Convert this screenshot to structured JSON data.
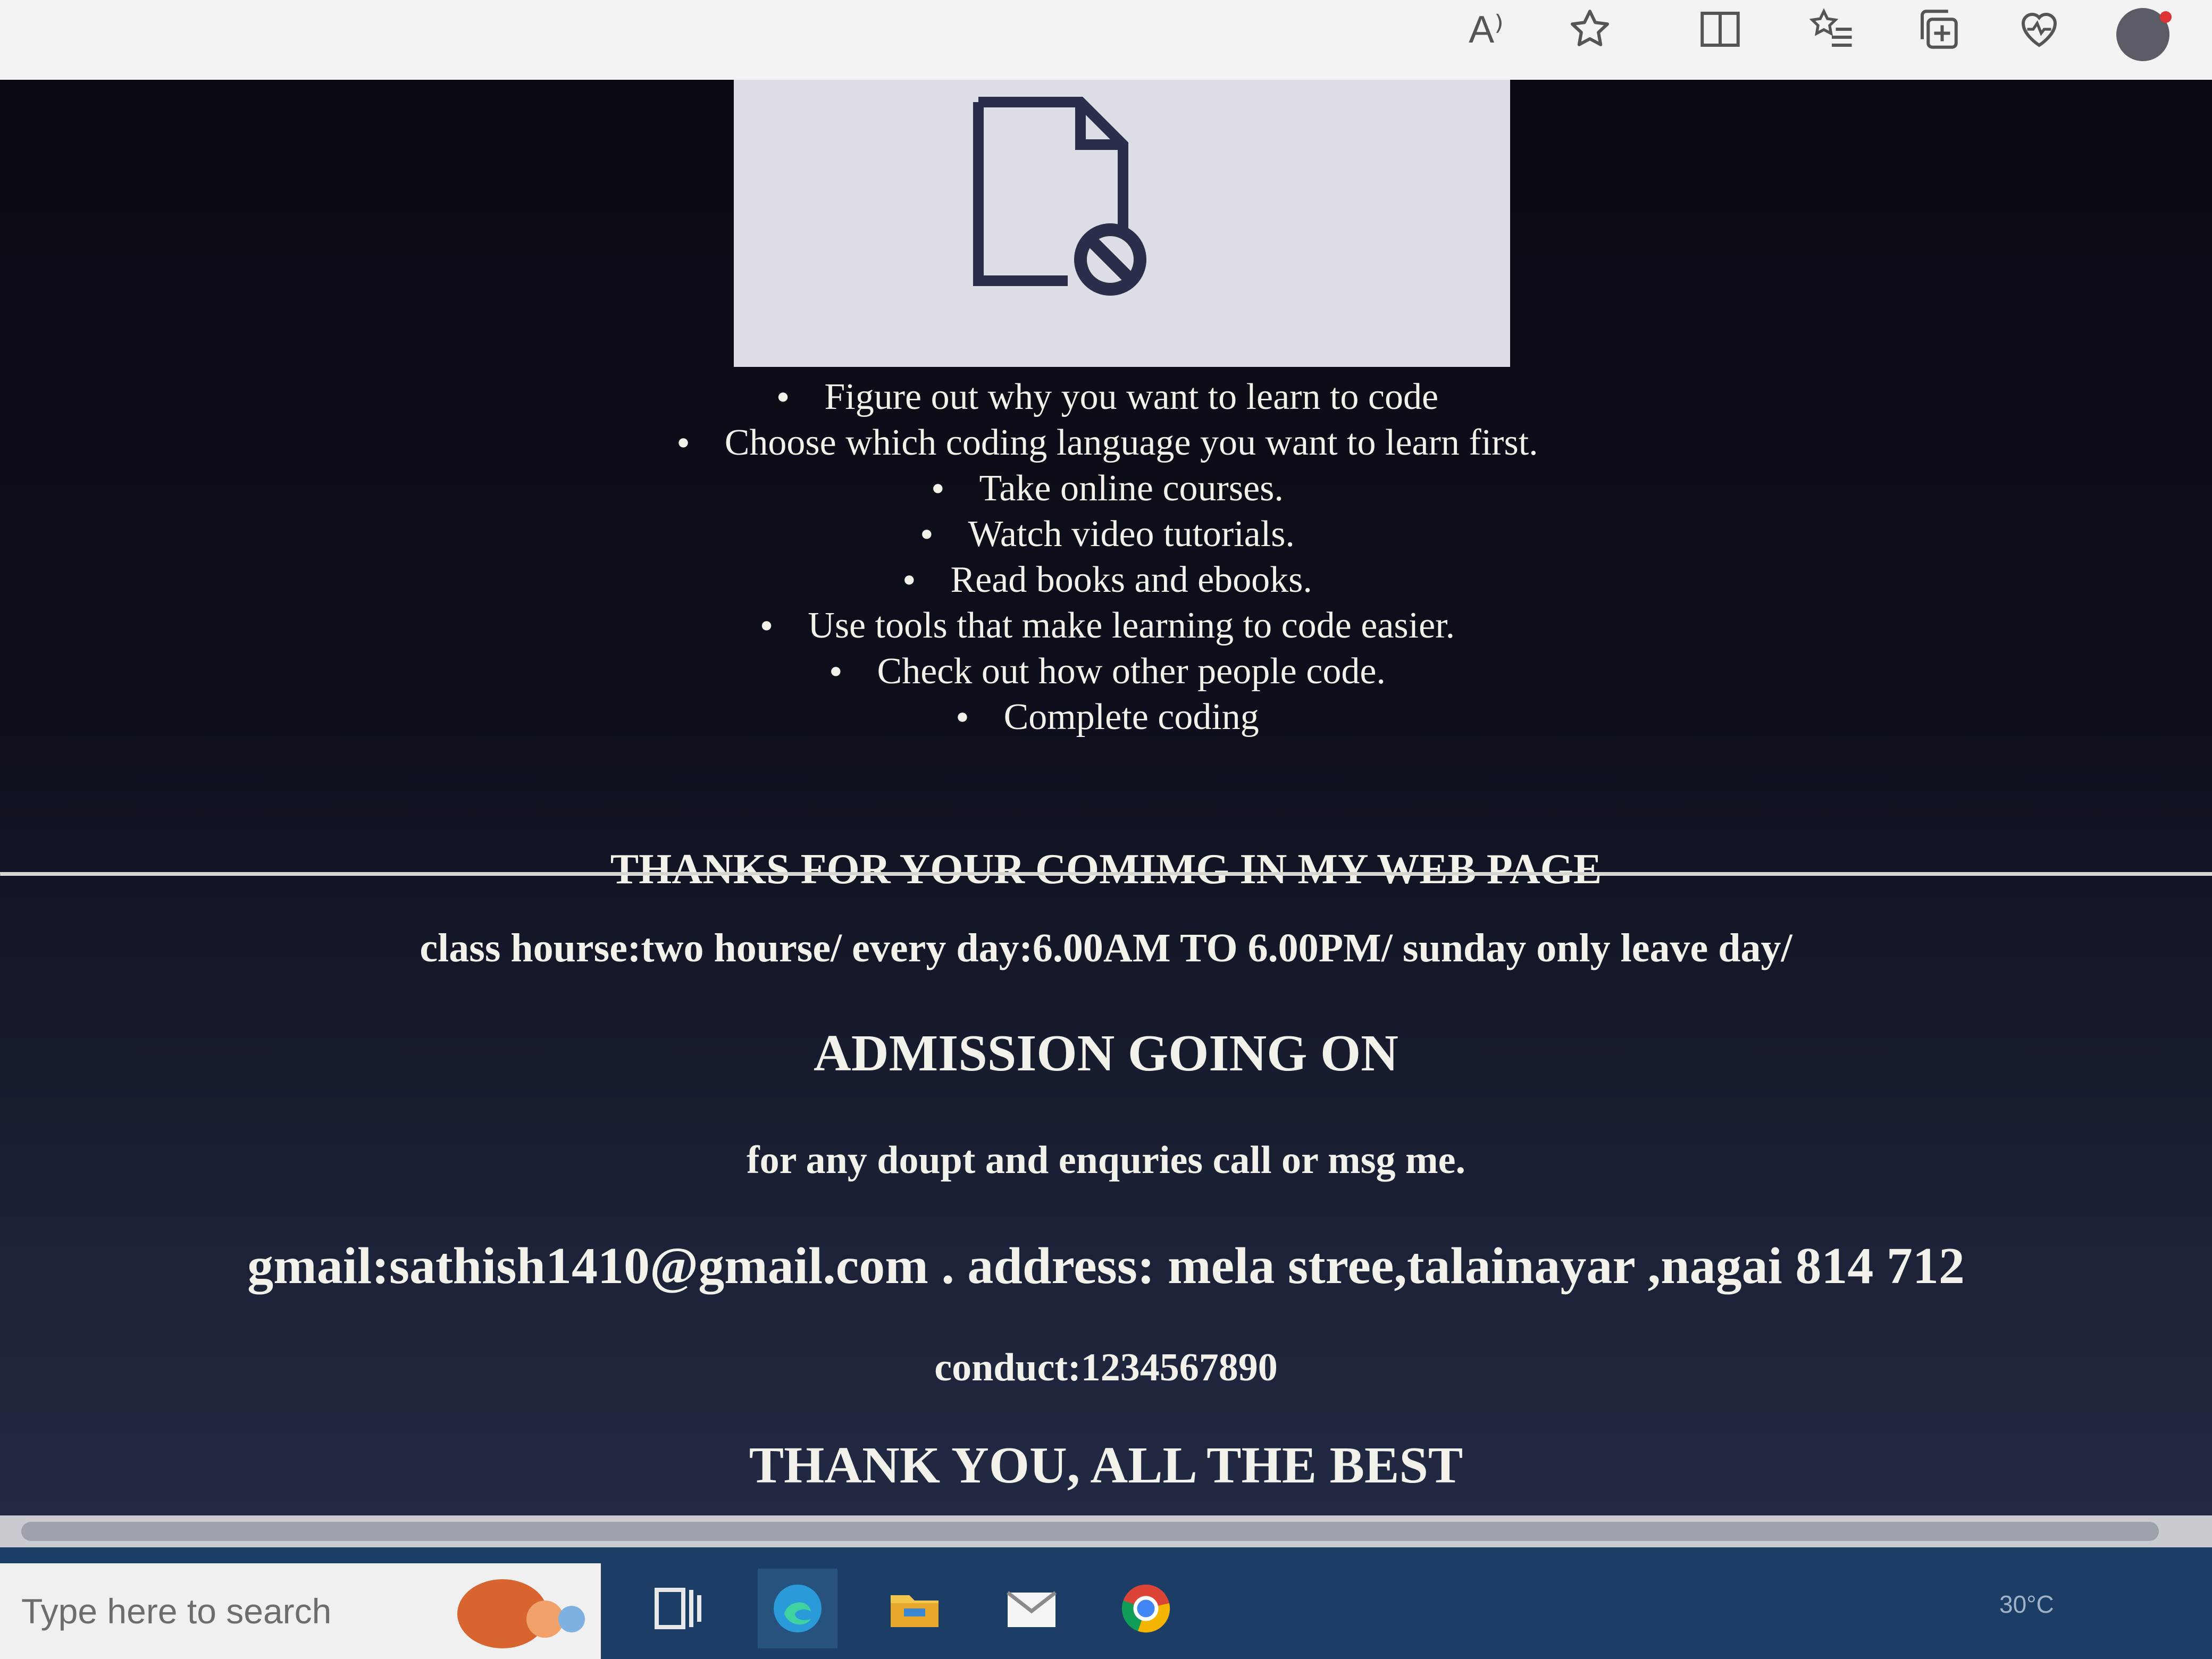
{
  "browser": {
    "toolbar_icons": [
      "read-aloud-icon",
      "favorite-star-icon",
      "split-screen-icon",
      "favorites-list-icon",
      "collections-icon",
      "performance-icon",
      "profile-icon"
    ],
    "read_aloud_label": "A⁾"
  },
  "page": {
    "image_status": "broken-image-icon",
    "steps": [
      "Figure out why you want to learn to code",
      "Choose which coding language you want to learn first.",
      "Take online courses.",
      "Watch video tutorials.",
      "Read books and ebooks.",
      "Use tools that make learning to code easier.",
      "Check out how other people code.",
      "Complete coding"
    ],
    "thanks_message": "THANKS FOR YOUR COMIMG IN MY WEB PAGE",
    "class_hours": "class hourse:two hourse/ every day:6.00AM TO 6.00PM/ sunday only leave day/",
    "admission": "ADMISSION GOING ON",
    "enquiries": "for any doupt and enquries call or msg me.",
    "contact": "gmail:sathish1410@gmail.com . address: mela stree,talainayar ,nagai 814 712",
    "conduct": "conduct:1234567890",
    "closing": "THANK YOU, ALL THE BEST"
  },
  "taskbar": {
    "search_placeholder": "Type here to search",
    "apps": [
      "task-view-icon",
      "edge-icon",
      "file-explorer-icon",
      "mail-icon",
      "chrome-icon"
    ],
    "tray_text": "30°C"
  },
  "colors": {
    "page_background": "#0b0c14",
    "text": "#f2f2ea",
    "taskbar": "#1c3d66"
  }
}
